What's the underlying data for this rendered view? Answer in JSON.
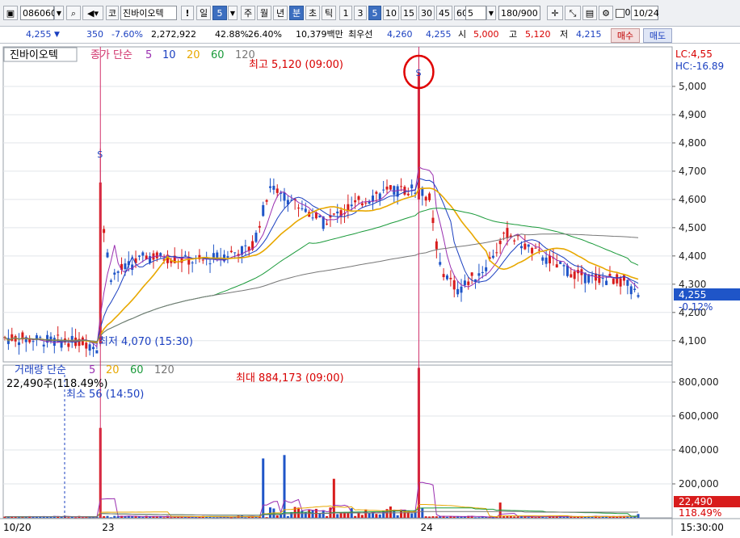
{
  "toolbar": {
    "code": "086060",
    "market_btn": "코",
    "name": "진바이오텍",
    "alert_btn": "!",
    "period_day": "일",
    "period_day_value": "5",
    "period_week": "주",
    "period_month": "월",
    "period_year": "년",
    "period_minute": "분",
    "period_second": "초",
    "period_tick": "틱",
    "intervals": [
      "1",
      "3",
      "5",
      "10",
      "15",
      "30",
      "45",
      "60"
    ],
    "selected_interval": "5",
    "interval_input": "5",
    "count": "180/900",
    "checkbox_value": "0",
    "date": "10/24"
  },
  "quote": {
    "price": "4,255",
    "arrow": "▼",
    "change": "350",
    "change_pct": "-7.60%",
    "volume": "2,272,922",
    "ratio1": "42.88%",
    "ratio2": "26.40%",
    "amount": "10,379백만",
    "best_ask_label": "최우선",
    "best_ask": "4,260",
    "best_bid": "4,255",
    "open_label": "시",
    "open": "5,000",
    "high_label": "고",
    "high": "5,120",
    "low_label": "저",
    "low": "4,215",
    "buy_btn": "매수",
    "sell_btn": "매도"
  },
  "chart_data": {
    "type": "candlestick",
    "title": "진바이오텍",
    "price_legend": {
      "label": "종가 단순",
      "periods": [
        "5",
        "10",
        "20",
        "60",
        "120"
      ],
      "colors": [
        "#9a2fb0",
        "#1a3fc0",
        "#e8a800",
        "#1a9a3a",
        "#777777"
      ]
    },
    "volume_legend": {
      "label": "거래량 단순",
      "periods": [
        "5",
        "20",
        "60",
        "120"
      ],
      "colors": [
        "#9a2fb0",
        "#e8a800",
        "#1a9a3a",
        "#777777"
      ]
    },
    "price_axis": {
      "ticks": [
        "4,100",
        "4,200",
        "4,300",
        "4,400",
        "4,500",
        "4,600",
        "4,700",
        "4,800",
        "4,900",
        "5,000"
      ],
      "range": [
        4025,
        5140
      ]
    },
    "volume_axis": {
      "ticks": [
        "200,000",
        "400,000",
        "600,000",
        "800,000"
      ],
      "range": [
        0,
        900000
      ]
    },
    "x_labels": [
      "10/20",
      "23",
      "24"
    ],
    "time_label": "15:30:00",
    "price_marker": {
      "value": "4,255",
      "pct": "-0.12%"
    },
    "volume_marker": {
      "value": "22,490",
      "pct": "118.49%"
    },
    "lc": "LC:4,55",
    "hc": "HC:-16.89",
    "max_price_label": "최고 5,120 (09:00)",
    "min_price_label": "최저 4,070 (15:30)",
    "max_volume_label": "최대 884,173 (09:00)",
    "min_volume_label": "최소 56 (14:50)",
    "volume_status": "22,490주(118.49%)"
  }
}
